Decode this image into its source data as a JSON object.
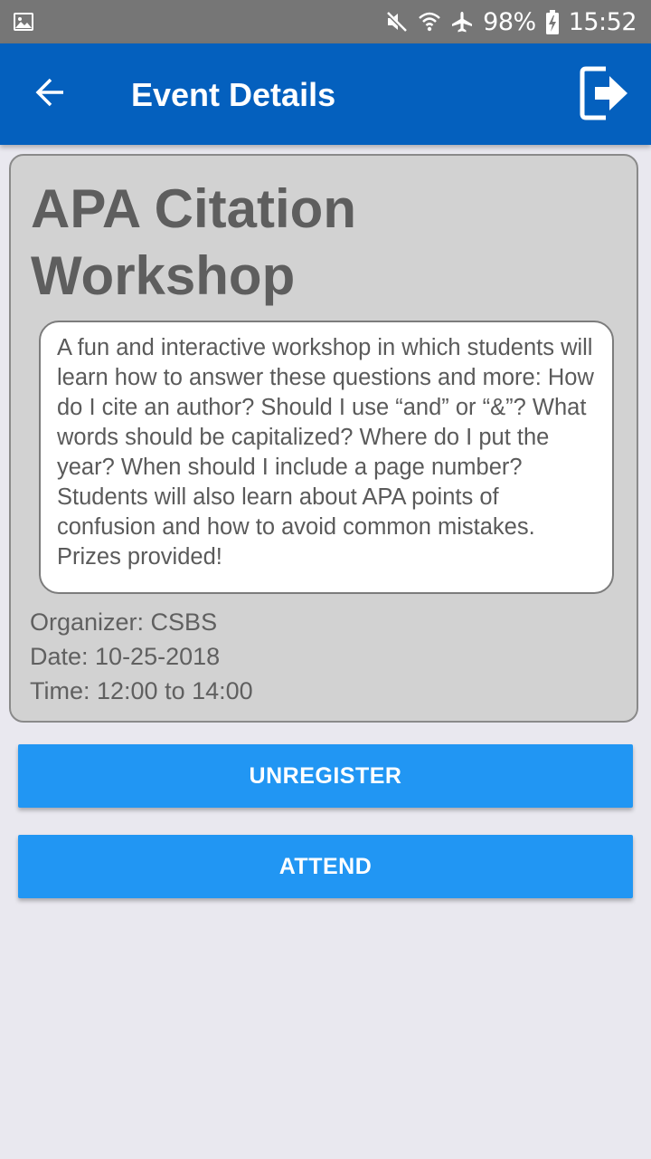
{
  "status_bar": {
    "left_icon": "image-icon",
    "icons": [
      "mute-icon",
      "wifi-icon",
      "airplane-mode-icon"
    ],
    "battery_percent": "98%",
    "battery_icon": "battery-charging-icon",
    "time": "15:52"
  },
  "app_bar": {
    "back_icon": "arrow-back-icon",
    "title": "Event Details",
    "exit_icon": "exit-icon"
  },
  "event": {
    "title": "APA Citation Workshop",
    "description": "A fun and interactive workshop in which students will learn how to answer these questions and more: How do I cite an author?  Should I use “and” or “&”?  What words should be capitalized?  Where do I put the year?  When should I include a page number?  Students will also learn about APA points of confusion and how to avoid common mistakes. Prizes provided!",
    "organizer": "Organizer: CSBS",
    "date": "Date: 10-25-2018",
    "time": "Time: 12:00 to 14:00"
  },
  "actions": {
    "unregister_label": "UNREGISTER",
    "attend_label": "ATTEND"
  },
  "colors": {
    "status_bar": "#767676",
    "app_bar": "#0460be",
    "button": "#2196f3",
    "card": "#d2d2d2",
    "background": "#e9e8ef"
  }
}
